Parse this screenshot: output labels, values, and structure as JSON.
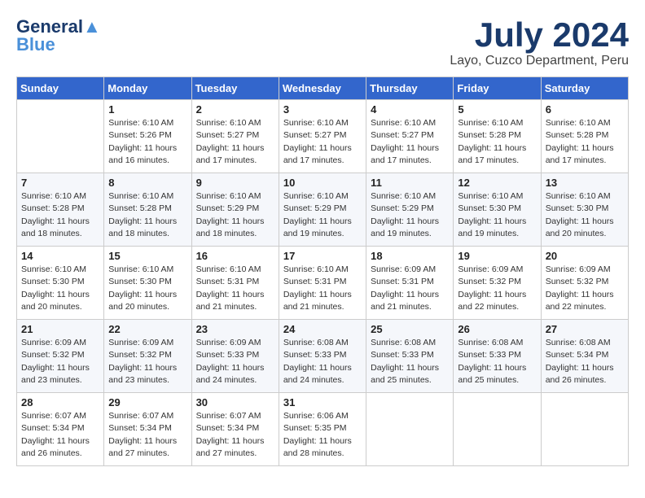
{
  "logo": {
    "line1": "General",
    "line2": "Blue"
  },
  "title": "July 2024",
  "location": "Layo, Cuzco Department, Peru",
  "days_of_week": [
    "Sunday",
    "Monday",
    "Tuesday",
    "Wednesday",
    "Thursday",
    "Friday",
    "Saturday"
  ],
  "weeks": [
    [
      {
        "day": "",
        "info": ""
      },
      {
        "day": "1",
        "info": "Sunrise: 6:10 AM\nSunset: 5:26 PM\nDaylight: 11 hours\nand 16 minutes."
      },
      {
        "day": "2",
        "info": "Sunrise: 6:10 AM\nSunset: 5:27 PM\nDaylight: 11 hours\nand 17 minutes."
      },
      {
        "day": "3",
        "info": "Sunrise: 6:10 AM\nSunset: 5:27 PM\nDaylight: 11 hours\nand 17 minutes."
      },
      {
        "day": "4",
        "info": "Sunrise: 6:10 AM\nSunset: 5:27 PM\nDaylight: 11 hours\nand 17 minutes."
      },
      {
        "day": "5",
        "info": "Sunrise: 6:10 AM\nSunset: 5:28 PM\nDaylight: 11 hours\nand 17 minutes."
      },
      {
        "day": "6",
        "info": "Sunrise: 6:10 AM\nSunset: 5:28 PM\nDaylight: 11 hours\nand 17 minutes."
      }
    ],
    [
      {
        "day": "7",
        "info": "Sunrise: 6:10 AM\nSunset: 5:28 PM\nDaylight: 11 hours\nand 18 minutes."
      },
      {
        "day": "8",
        "info": "Sunrise: 6:10 AM\nSunset: 5:28 PM\nDaylight: 11 hours\nand 18 minutes."
      },
      {
        "day": "9",
        "info": "Sunrise: 6:10 AM\nSunset: 5:29 PM\nDaylight: 11 hours\nand 18 minutes."
      },
      {
        "day": "10",
        "info": "Sunrise: 6:10 AM\nSunset: 5:29 PM\nDaylight: 11 hours\nand 19 minutes."
      },
      {
        "day": "11",
        "info": "Sunrise: 6:10 AM\nSunset: 5:29 PM\nDaylight: 11 hours\nand 19 minutes."
      },
      {
        "day": "12",
        "info": "Sunrise: 6:10 AM\nSunset: 5:30 PM\nDaylight: 11 hours\nand 19 minutes."
      },
      {
        "day": "13",
        "info": "Sunrise: 6:10 AM\nSunset: 5:30 PM\nDaylight: 11 hours\nand 20 minutes."
      }
    ],
    [
      {
        "day": "14",
        "info": "Sunrise: 6:10 AM\nSunset: 5:30 PM\nDaylight: 11 hours\nand 20 minutes."
      },
      {
        "day": "15",
        "info": "Sunrise: 6:10 AM\nSunset: 5:30 PM\nDaylight: 11 hours\nand 20 minutes."
      },
      {
        "day": "16",
        "info": "Sunrise: 6:10 AM\nSunset: 5:31 PM\nDaylight: 11 hours\nand 21 minutes."
      },
      {
        "day": "17",
        "info": "Sunrise: 6:10 AM\nSunset: 5:31 PM\nDaylight: 11 hours\nand 21 minutes."
      },
      {
        "day": "18",
        "info": "Sunrise: 6:09 AM\nSunset: 5:31 PM\nDaylight: 11 hours\nand 21 minutes."
      },
      {
        "day": "19",
        "info": "Sunrise: 6:09 AM\nSunset: 5:32 PM\nDaylight: 11 hours\nand 22 minutes."
      },
      {
        "day": "20",
        "info": "Sunrise: 6:09 AM\nSunset: 5:32 PM\nDaylight: 11 hours\nand 22 minutes."
      }
    ],
    [
      {
        "day": "21",
        "info": "Sunrise: 6:09 AM\nSunset: 5:32 PM\nDaylight: 11 hours\nand 23 minutes."
      },
      {
        "day": "22",
        "info": "Sunrise: 6:09 AM\nSunset: 5:32 PM\nDaylight: 11 hours\nand 23 minutes."
      },
      {
        "day": "23",
        "info": "Sunrise: 6:09 AM\nSunset: 5:33 PM\nDaylight: 11 hours\nand 24 minutes."
      },
      {
        "day": "24",
        "info": "Sunrise: 6:08 AM\nSunset: 5:33 PM\nDaylight: 11 hours\nand 24 minutes."
      },
      {
        "day": "25",
        "info": "Sunrise: 6:08 AM\nSunset: 5:33 PM\nDaylight: 11 hours\nand 25 minutes."
      },
      {
        "day": "26",
        "info": "Sunrise: 6:08 AM\nSunset: 5:33 PM\nDaylight: 11 hours\nand 25 minutes."
      },
      {
        "day": "27",
        "info": "Sunrise: 6:08 AM\nSunset: 5:34 PM\nDaylight: 11 hours\nand 26 minutes."
      }
    ],
    [
      {
        "day": "28",
        "info": "Sunrise: 6:07 AM\nSunset: 5:34 PM\nDaylight: 11 hours\nand 26 minutes."
      },
      {
        "day": "29",
        "info": "Sunrise: 6:07 AM\nSunset: 5:34 PM\nDaylight: 11 hours\nand 27 minutes."
      },
      {
        "day": "30",
        "info": "Sunrise: 6:07 AM\nSunset: 5:34 PM\nDaylight: 11 hours\nand 27 minutes."
      },
      {
        "day": "31",
        "info": "Sunrise: 6:06 AM\nSunset: 5:35 PM\nDaylight: 11 hours\nand 28 minutes."
      },
      {
        "day": "",
        "info": ""
      },
      {
        "day": "",
        "info": ""
      },
      {
        "day": "",
        "info": ""
      }
    ]
  ]
}
